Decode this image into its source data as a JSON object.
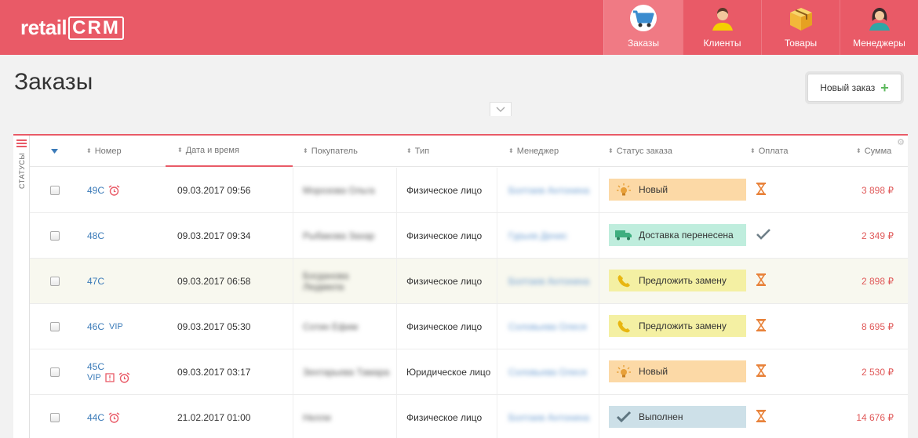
{
  "app": {
    "logo_text": "retail",
    "logo_crm": "CRM",
    "nav": [
      {
        "label": "Заказы",
        "icon": "cart-icon",
        "active": true
      },
      {
        "label": "Клиенты",
        "icon": "client-avatar-icon",
        "active": false
      },
      {
        "label": "Товары",
        "icon": "box-icon",
        "active": false
      },
      {
        "label": "Менеджеры",
        "icon": "manager-avatar-icon",
        "active": false
      }
    ],
    "accent_color": "#e95a67"
  },
  "page": {
    "title": "Заказы",
    "new_order_label": "Новый заказ",
    "new_order_plus": "+",
    "side_label": "Статусы"
  },
  "table": {
    "headers": {
      "number": "Номер",
      "datetime": "Дата и время",
      "customer": "Покупатель",
      "type": "Тип",
      "manager": "Менеджер",
      "status": "Статус заказа",
      "payment": "Оплата",
      "sum": "Сумма"
    },
    "rows": [
      {
        "number": "49C",
        "vip": "",
        "alarm": true,
        "flag": false,
        "datetime": "09.03.2017 09:56",
        "customer": "Морозова Ольга",
        "type": "Физическое лицо",
        "manager": "Болтаев Антонина",
        "status": "Новый",
        "status_color": "#fcd9a6",
        "status_icon": "bulb-icon",
        "payment": "pending",
        "sum": "3 898 ₽"
      },
      {
        "number": "48C",
        "vip": "",
        "alarm": false,
        "flag": false,
        "datetime": "09.03.2017 09:34",
        "customer": "Рыбакова Захар",
        "type": "Физическое лицо",
        "manager": "Гурьев Денис",
        "status": "Доставка перенесена",
        "status_color": "#bfeddd",
        "status_icon": "truck-icon",
        "payment": "paid",
        "sum": "2 349 ₽"
      },
      {
        "number": "47C",
        "vip": "",
        "alarm": false,
        "flag": false,
        "datetime": "09.03.2017 06:58",
        "customer": "Богданова Людмила",
        "type": "Физическое лицо",
        "manager": "Болтаев Антонина",
        "status": "Предложить замену",
        "status_color": "#f4f0a3",
        "status_icon": "phone-icon",
        "payment": "pending",
        "sum": "2 898 ₽"
      },
      {
        "number": "46C",
        "vip": "VIP",
        "alarm": false,
        "flag": false,
        "datetime": "09.03.2017 05:30",
        "customer": "Сотин Ефим",
        "type": "Физическое лицо",
        "manager": "Соловьева Олеся",
        "status": "Предложить замену",
        "status_color": "#f4f0a3",
        "status_icon": "phone-icon",
        "payment": "pending",
        "sum": "8 695 ₽"
      },
      {
        "number": "45C",
        "vip": "VIP",
        "alarm": true,
        "flag": true,
        "datetime": "09.03.2017 03:17",
        "customer": "Зентарьева Тамара",
        "type": "Юридическое лицо",
        "manager": "Соловьева Олеся",
        "status": "Новый",
        "status_color": "#fcd9a6",
        "status_icon": "bulb-icon",
        "payment": "pending",
        "sum": "2 530 ₽"
      },
      {
        "number": "44C",
        "vip": "",
        "alarm": true,
        "flag": false,
        "datetime": "21.02.2017 01:00",
        "customer": "Нелли",
        "type": "Физическое лицо",
        "manager": "Болтаев Антонина",
        "status": "Выполнен",
        "status_color": "#cde0e8",
        "status_icon": "check-icon",
        "payment": "pending",
        "sum": "14 676 ₽"
      }
    ]
  }
}
